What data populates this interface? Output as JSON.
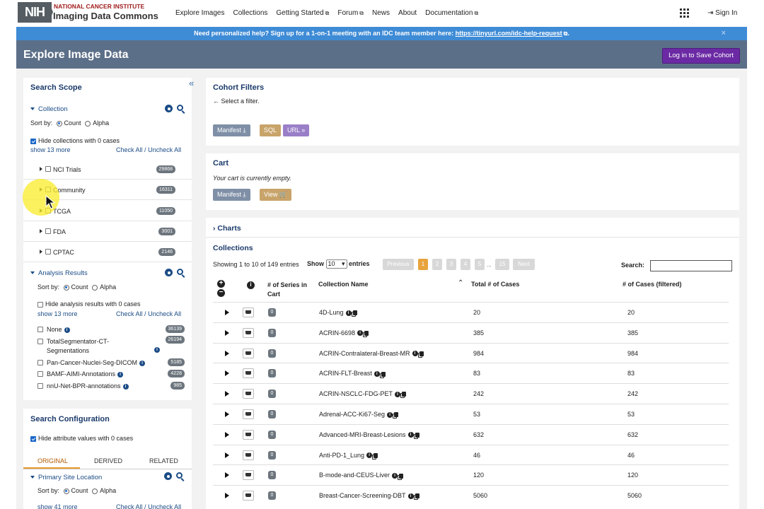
{
  "header": {
    "logo_nih": "NIH",
    "logo_line1": "NATIONAL CANCER INSTITUTE",
    "logo_line2": "Imaging Data Commons",
    "nav": [
      "Explore Images",
      "Collections",
      "Getting Started",
      "Forum",
      "News",
      "About",
      "Documentation"
    ],
    "nav_external": [
      false,
      false,
      true,
      true,
      false,
      false,
      true
    ],
    "signin": "Sign In"
  },
  "banner": {
    "text": "Need personalized help? Sign up for a 1-on-1 meeting with an IDC team member here:",
    "link": "https://tinyurl.com/idc-help-request",
    "close": "×"
  },
  "titlebar": {
    "title": "Explore Image Data",
    "save_label": "Log in to Save Cohort"
  },
  "search_scope": {
    "title": "Search Scope",
    "collapse_glyph": "«",
    "collection": {
      "title": "Collection",
      "sort_label": "Sort by:",
      "sort_count": "Count",
      "sort_alpha": "Alpha",
      "hide_zero": "Hide collections with 0 cases",
      "show_more": "show 13 more",
      "check_all": "Check All",
      "separator": "/",
      "uncheck_all": "Uncheck All",
      "items": [
        {
          "label": "NCI Trials",
          "count": "29868"
        },
        {
          "label": "Community",
          "count": "16311"
        },
        {
          "label": "TCGA",
          "count": "11050"
        },
        {
          "label": "FDA",
          "count": "3001"
        },
        {
          "label": "CPTAC",
          "count": "2146"
        }
      ]
    },
    "analysis": {
      "title": "Analysis Results",
      "sort_label": "Sort by:",
      "sort_count": "Count",
      "sort_alpha": "Alpha",
      "hide_zero": "Hide analysis results with 0 cases",
      "show_more": "show 13 more",
      "check_all": "Check All",
      "separator": "/",
      "uncheck_all": "Uncheck All",
      "items": [
        {
          "label": "None",
          "count": "36139"
        },
        {
          "label": "TotalSegmentator-CT-",
          "label2": "Segmentations",
          "count": "26194"
        },
        {
          "label": "Pan-Cancer-Nuclei-Seg-DICOM",
          "count": "5185"
        },
        {
          "label": "BAMF-AIMI-Annotations",
          "count": "4228"
        },
        {
          "label": "nnU-Net-BPR-annotations",
          "count": "985"
        }
      ]
    }
  },
  "search_config": {
    "title": "Search Configuration",
    "hide_zero": "Hide attribute values with 0 cases",
    "tabs": [
      "ORIGINAL",
      "DERIVED",
      "RELATED"
    ],
    "primary_site": {
      "title": "Primary Site Location",
      "sort_label": "Sort by:",
      "sort_count": "Count",
      "sort_alpha": "Alpha",
      "show_more": "show 41 more",
      "check_all": "Check All",
      "separator": "/",
      "uncheck_all": "Uncheck All"
    }
  },
  "cohort": {
    "title": "Cohort Filters",
    "hint": "← Select a filter.",
    "manifest": "Manifest",
    "sql": "SQL",
    "url": "URL"
  },
  "cart": {
    "title": "Cart",
    "empty": "Your cart is currently empty.",
    "manifest": "Manifest",
    "view": "View"
  },
  "charts": {
    "title": "Charts"
  },
  "collections": {
    "title": "Collections",
    "showing": "Showing 1 to 10 of 149 entries",
    "show": "Show",
    "page_size": "10",
    "entries": "entries",
    "search_label": "Search:",
    "pager": {
      "previous": "Previous",
      "pages": [
        "1",
        "2",
        "3",
        "4",
        "5"
      ],
      "ellipsis": "...",
      "last": "15",
      "next": "Next"
    },
    "headers": {
      "series": "# of Series in Cart",
      "name": "Collection Name",
      "total": "Total # of Cases",
      "filtered": "# of Cases (filtered)"
    },
    "rows": [
      {
        "cart": "0",
        "name": "4D-Lung",
        "total": "20",
        "filtered": "20"
      },
      {
        "cart": "0",
        "name": "ACRIN-6698",
        "total": "385",
        "filtered": "385"
      },
      {
        "cart": "0",
        "name": "ACRIN-Contralateral-Breast-MR",
        "total": "984",
        "filtered": "984"
      },
      {
        "cart": "0",
        "name": "ACRIN-FLT-Breast",
        "total": "83",
        "filtered": "83"
      },
      {
        "cart": "0",
        "name": "ACRIN-NSCLC-FDG-PET",
        "total": "242",
        "filtered": "242"
      },
      {
        "cart": "0",
        "name": "Adrenal-ACC-Ki67-Seg",
        "total": "53",
        "filtered": "53"
      },
      {
        "cart": "0",
        "name": "Advanced-MRI-Breast-Lesions",
        "total": "632",
        "filtered": "632"
      },
      {
        "cart": "0",
        "name": "Anti-PD-1_Lung",
        "total": "46",
        "filtered": "46"
      },
      {
        "cart": "0",
        "name": "B-mode-and-CEUS-Liver",
        "total": "120",
        "filtered": "120"
      },
      {
        "cart": "0",
        "name": "Breast-Cancer-Screening-DBT",
        "total": "5060",
        "filtered": "5060"
      }
    ]
  },
  "colors": {
    "title_bar": "#5c6f88",
    "banner": "#3e8bd6",
    "save_button": "#6b2aa4",
    "active_page": "#e8a33c"
  }
}
